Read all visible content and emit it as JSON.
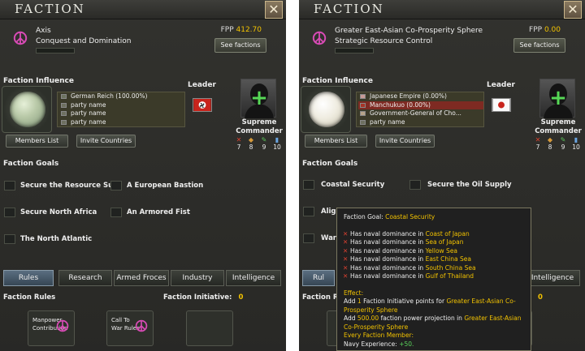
{
  "left": {
    "title": "Faction",
    "close_label": "✕",
    "name": "Axis",
    "ideology": "Conquest and Domination",
    "fpp_label": "FPP",
    "fpp_value": "412.70",
    "see_factions": "See factions",
    "influence_label": "Faction Influence",
    "members": [
      "German Reich (100.00%)",
      "party name",
      "party name",
      "party name"
    ],
    "leader_label": "Leader",
    "leader_title_1": "Supreme",
    "leader_title_2": "Commander",
    "stats": [
      "7",
      "8",
      "9",
      "10"
    ],
    "members_list_btn": "Members List",
    "invite_btn": "Invite Countries",
    "goals_title": "Faction Goals",
    "goals": [
      "Secure the Resource Su...",
      "A European Bastion",
      "Secure North Africa",
      "An Armored Fist",
      "The North Atlantic"
    ],
    "tabs": [
      "Rules",
      "Research",
      "Armed Froces",
      "Industry",
      "Intelligence"
    ],
    "rules_title": "Faction Rules",
    "initiative_label": "Faction Initiative:",
    "initiative_value": "0",
    "rule_cards": [
      "Manpower Contribution",
      "Call To War Rules"
    ]
  },
  "right": {
    "title": "Faction",
    "close_label": "✕",
    "name": "Greater East-Asian Co-Prosperity Sphere",
    "ideology": "Strategic Resource Control",
    "fpp_label": "FPP",
    "fpp_value": "0.00",
    "see_factions": "See factions",
    "influence_label": "Faction Influence",
    "members": [
      "Japanese Empire (0.00%)",
      "Manchukuo (0.00%)",
      "Government-General of Cho...",
      "party name"
    ],
    "leader_label": "Leader",
    "leader_title_1": "Supreme",
    "leader_title_2": "Commander",
    "stats": [
      "7",
      "8",
      "9",
      "10"
    ],
    "members_list_btn": "Members List",
    "invite_btn": "Invite Countries",
    "goals_title": "Faction Goals",
    "goals": [
      "Coastal Security",
      "Secure the Oil Supply",
      "Aligi",
      "War"
    ],
    "tabs": [
      "Rul",
      "Intelligence"
    ],
    "rules_title": "Faction Ru",
    "initiative_value": "0"
  },
  "tooltip": {
    "goal_label": "Faction Goal:",
    "goal_name": "Coastal Security",
    "dominance_prefix": "Has naval dominance in",
    "seas": [
      "Coast of Japan",
      "Sea of Japan",
      "Yellow Sea",
      "East China Sea",
      "South China Sea",
      "Gulf of Thailand"
    ],
    "effect_label": "Effect:",
    "add_word": "Add",
    "add_value_1": "1",
    "add_text_1": "Faction Initiative points for",
    "faction_name": "Greater East-Asian Co-Prosperity Sphere",
    "add_value_2": "500.00",
    "add_text_2": "faction power projection in",
    "every_member": "Every Faction Member:",
    "navy_label": "Navy Experience:",
    "navy_value": "+50."
  },
  "colors": {
    "accent_yellow": "#f2c200",
    "green": "#59d35a",
    "red_x": "#d94030",
    "active_tab": "#4e6272",
    "peace_pink": "#d94bb6"
  }
}
